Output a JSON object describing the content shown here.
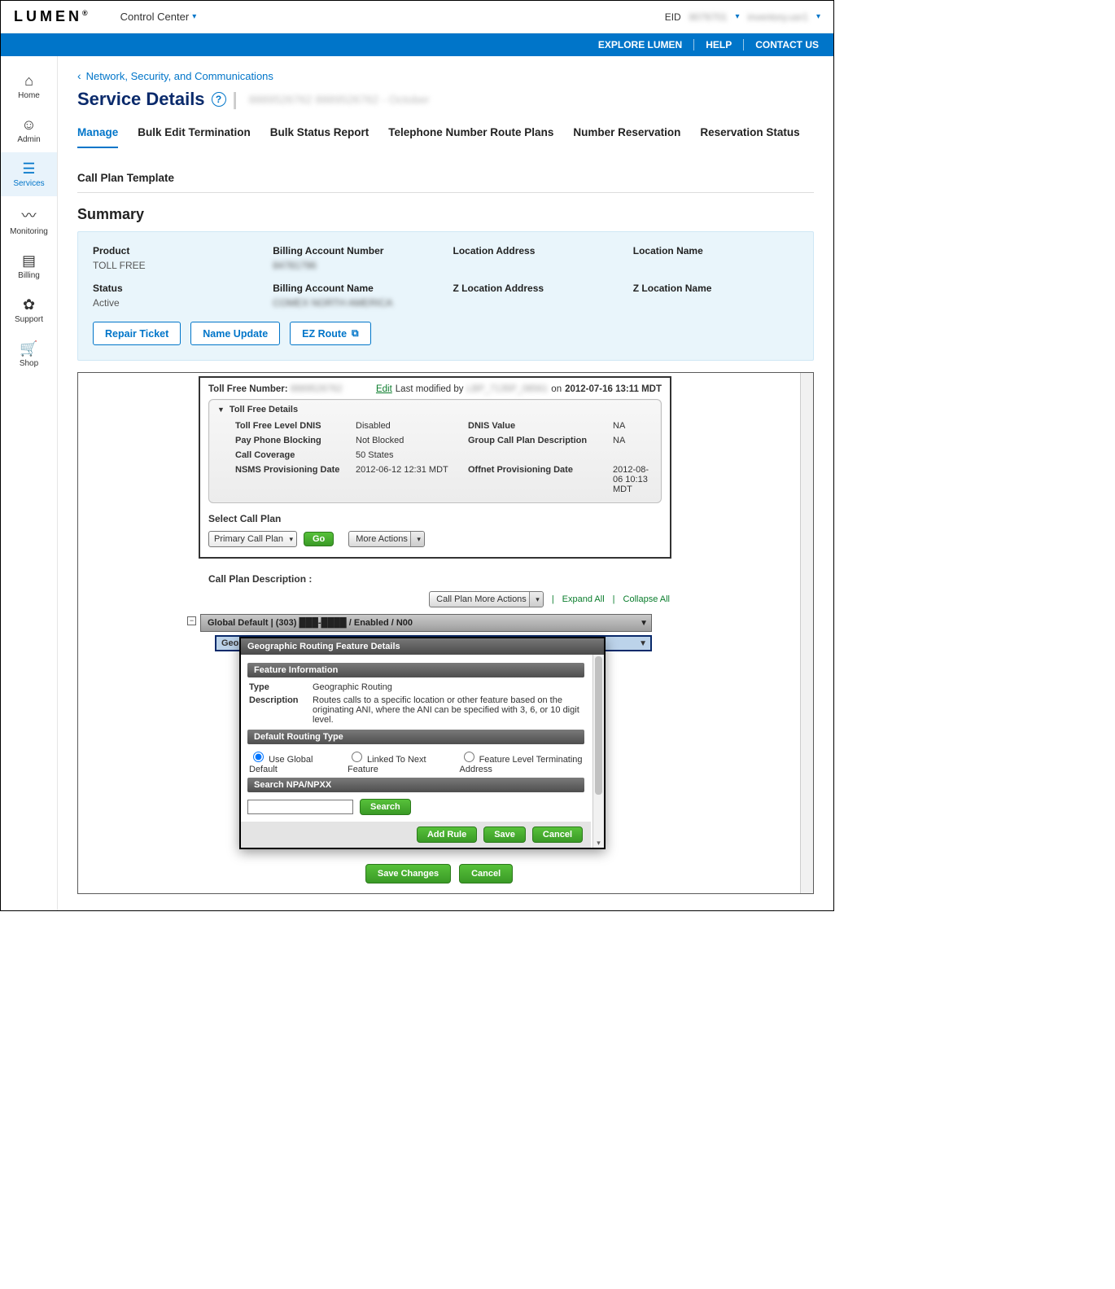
{
  "topbar": {
    "brand": "LUMEN",
    "brand_suffix": "®",
    "dropdown": "Control Center",
    "eid_label": "EID",
    "eid_value": "8076701",
    "user": "inventory.usr1"
  },
  "bluebar": {
    "explore": "EXPLORE LUMEN",
    "help": "HELP",
    "contact": "CONTACT US"
  },
  "sidenav": {
    "home": "Home",
    "admin": "Admin",
    "services": "Services",
    "monitoring": "Monitoring",
    "billing": "Billing",
    "support": "Support",
    "shop": "Shop"
  },
  "breadcrumb": "Network, Security, and Communications",
  "page_title": "Service Details",
  "title_meta": "8889526762   8889526762 - October",
  "tabs": {
    "manage": "Manage",
    "bulk_edit": "Bulk Edit Termination",
    "bulk_status": "Bulk Status Report",
    "route_plans": "Telephone Number Route Plans",
    "number_res": "Number Reservation",
    "res_status": "Reservation Status",
    "call_plan_tpl": "Call Plan Template"
  },
  "summary": {
    "heading": "Summary",
    "product_label": "Product",
    "product_value": "TOLL FREE",
    "status_label": "Status",
    "status_value": "Active",
    "ban_label": "Billing Account Number",
    "ban_value": "84781796",
    "baname_label": "Billing Account Name",
    "baname_value": "COMEX NORTH AMERICA",
    "loc_addr_label": "Location Address",
    "zloc_addr_label": "Z Location Address",
    "loc_name_label": "Location Name",
    "zloc_name_label": "Z Location Name",
    "repair_btn": "Repair Ticket",
    "name_btn": "Name Update",
    "ezroute_btn": "EZ Route"
  },
  "tollfree": {
    "number_label": "Toll Free Number:",
    "number_value": "8889526762",
    "edit": "Edit",
    "modified_prefix": "Last modified by",
    "modified_user": "LBP_7135P_08561",
    "modified_on": "on",
    "modified_ts": "2012-07-16 13:11 MDT",
    "details_title": "Toll Free Details",
    "rows": {
      "dnis_label": "Toll Free Level DNIS",
      "dnis_value": "Disabled",
      "dnisv_label": "DNIS Value",
      "dnisv_value": "NA",
      "pay_label": "Pay Phone Blocking",
      "pay_value": "Not Blocked",
      "grp_label": "Group Call Plan Description",
      "grp_value": "NA",
      "cov_label": "Call Coverage",
      "cov_value": "50 States",
      "nsms_label": "NSMS Provisioning Date",
      "nsms_value": "2012-06-12 12:31 MDT",
      "offnet_label": "Offnet Provisioning Date",
      "offnet_value": "2012-08-06 10:13 MDT"
    },
    "select_label": "Select Call Plan",
    "select_value": "Primary Call Plan",
    "go": "Go",
    "more_actions": "More Actions"
  },
  "callplan": {
    "desc_label": "Call Plan Description :",
    "more_actions": "Call Plan More Actions",
    "expand": "Expand All",
    "collapse": "Collapse All",
    "global_default": "Global Default | (303) ███-████ / Enabled / N00",
    "sub_row": "Geo"
  },
  "modal": {
    "title": "Geographic Routing Feature Details",
    "feature_info": "Feature Information",
    "type_label": "Type",
    "type_value": "Geographic Routing",
    "desc_label": "Description",
    "desc_value": "Routes calls to a specific location or other feature based on the originating ANI, where the ANI can be specified with 3, 6, or 10 digit level.",
    "def_routing": "Default Routing Type",
    "radio1": "Use Global Default",
    "radio2": "Linked To Next Feature",
    "radio3": "Feature Level Terminating Address",
    "search_head": "Search NPA/NPXX",
    "search_btn": "Search",
    "add_rule": "Add Rule",
    "save": "Save",
    "cancel": "Cancel"
  },
  "bottom": {
    "save": "Save Changes",
    "cancel": "Cancel"
  }
}
